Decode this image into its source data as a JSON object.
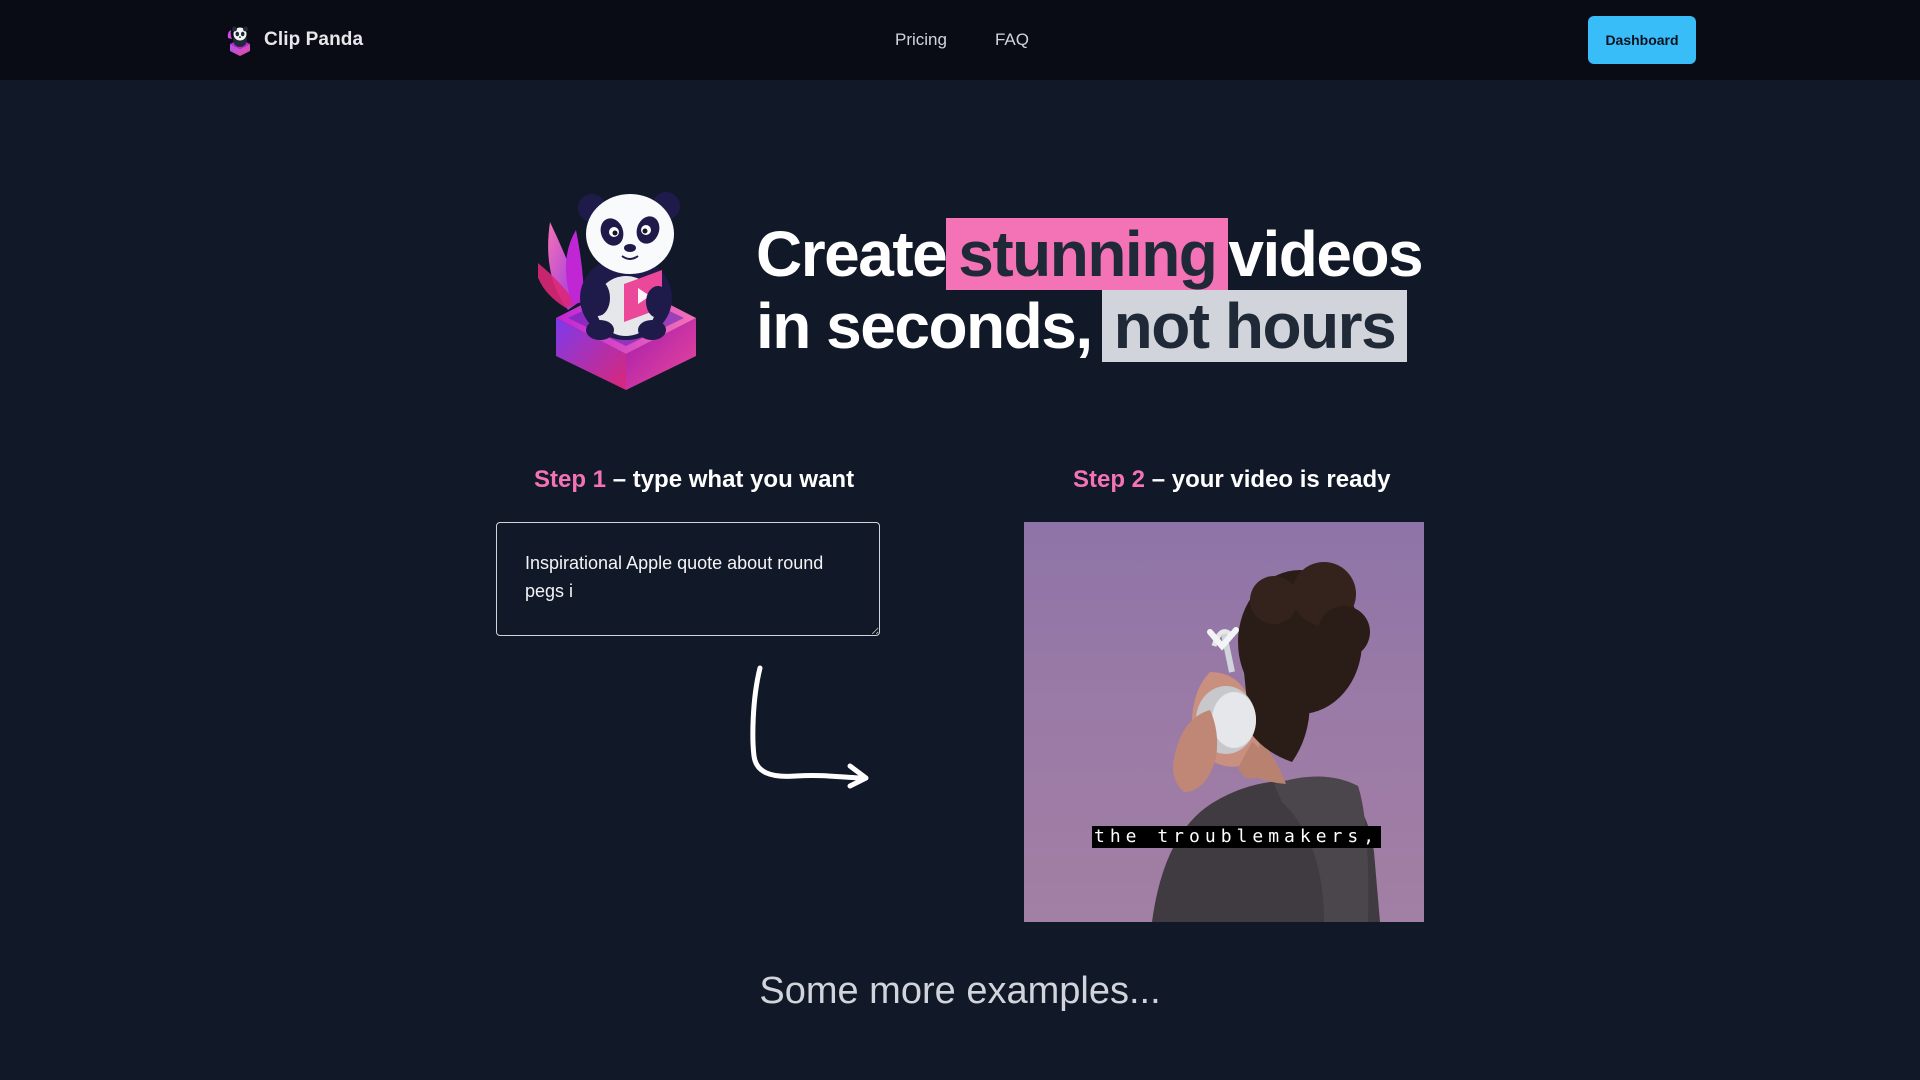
{
  "brand": {
    "name": "Clip Panda",
    "logo_icon": "panda-logo-icon"
  },
  "nav": {
    "items": [
      {
        "label": "Pricing"
      },
      {
        "label": "FAQ"
      }
    ]
  },
  "header": {
    "dashboard_label": "Dashboard",
    "dashboard_color": "#38bdf8"
  },
  "hero": {
    "line1_pre": "Create",
    "line1_highlight": "stunning",
    "line1_post": "videos",
    "line2_pre": "in seconds,",
    "line2_highlight": "not hours",
    "highlight_pink": "#f472b6",
    "highlight_gray": "#d1d5db",
    "mascot_icon": "panda-mascot-icon"
  },
  "steps": {
    "step1": {
      "number": "Step 1",
      "text": "– type what you want"
    },
    "step2": {
      "number": "Step 2",
      "text": "– your video is ready"
    }
  },
  "prompt": {
    "value": "Inspirational Apple quote about round pegs i"
  },
  "arrow_icon": "curved-arrow-icon",
  "video": {
    "subtitle": "the troublemakers,"
  },
  "examples": {
    "heading": "Some more examples..."
  }
}
